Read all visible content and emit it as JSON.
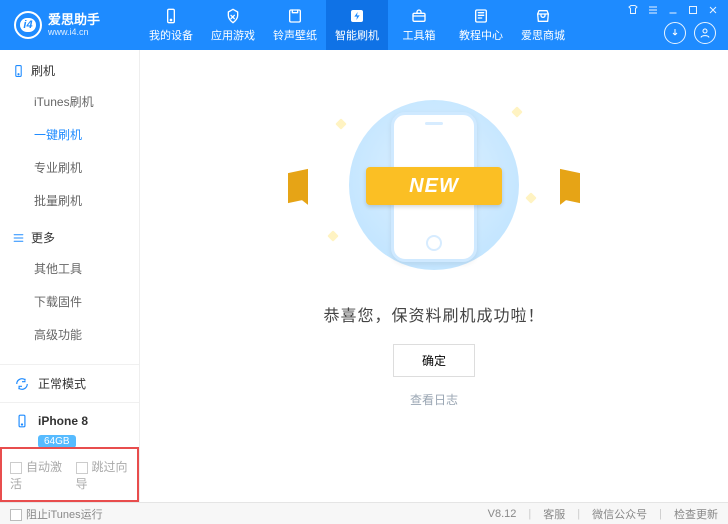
{
  "brand": {
    "name": "爱思助手",
    "url": "www.i4.cn",
    "logo_text": "i4"
  },
  "nav": [
    {
      "label": "我的设备",
      "icon": "device-icon"
    },
    {
      "label": "应用游戏",
      "icon": "apps-icon"
    },
    {
      "label": "铃声壁纸",
      "icon": "music-icon"
    },
    {
      "label": "智能刷机",
      "icon": "flash-icon",
      "active": true
    },
    {
      "label": "工具箱",
      "icon": "toolbox-icon"
    },
    {
      "label": "教程中心",
      "icon": "book-icon"
    },
    {
      "label": "爱思商城",
      "icon": "store-icon"
    }
  ],
  "sidebar_sections": [
    {
      "title": "刷机",
      "icon": "device-icon",
      "items": [
        {
          "label": "iTunes刷机"
        },
        {
          "label": "一键刷机",
          "active": true
        },
        {
          "label": "专业刷机"
        },
        {
          "label": "批量刷机"
        }
      ]
    },
    {
      "title": "更多",
      "icon": "list-icon",
      "items": [
        {
          "label": "其他工具"
        },
        {
          "label": "下载固件"
        },
        {
          "label": "高级功能"
        }
      ]
    }
  ],
  "mode": {
    "label": "正常模式",
    "icon": "refresh-icon"
  },
  "device": {
    "name": "iPhone 8",
    "storage": "64GB",
    "icon": "phone-icon"
  },
  "bottom_checks": {
    "auto_activate": "自动激活",
    "skip_guide": "跳过向导"
  },
  "main": {
    "ribbon": "NEW",
    "success": "恭喜您，保资料刷机成功啦！",
    "ok": "确定",
    "log": "查看日志"
  },
  "statusbar": {
    "block_itunes": "阻止iTunes运行",
    "version": "V8.12",
    "support": "客服",
    "wechat": "微信公众号",
    "update": "检查更新"
  }
}
